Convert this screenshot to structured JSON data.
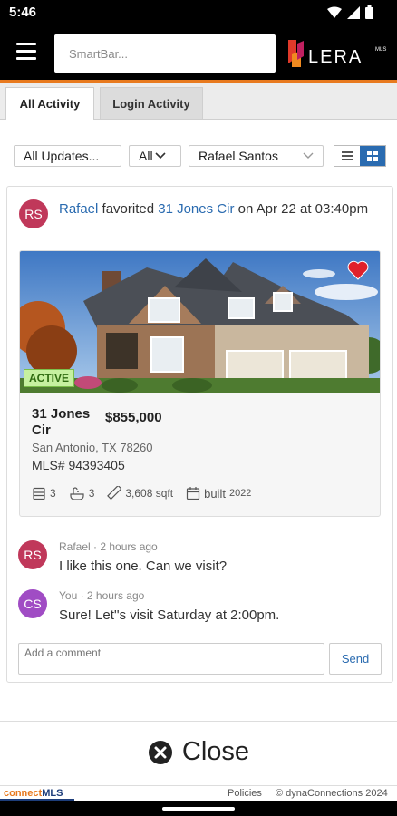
{
  "status_bar": {
    "time": "5:46"
  },
  "app_bar": {
    "search_placeholder": "SmartBar...",
    "logo_text": "LERA",
    "logo_sup": "MLS"
  },
  "tabs": [
    {
      "label": "All Activity"
    },
    {
      "label": "Login Activity"
    }
  ],
  "filters": {
    "updates": "All Updates...",
    "scope": "All",
    "agent": "Rafael Santos"
  },
  "activity": {
    "avatar_initials": "RS",
    "user": "Rafael",
    "verb": " favorited ",
    "listing_link": "31 Jones Cir",
    "date_text": " on Apr 22 at 03:40pm"
  },
  "listing": {
    "status": "ACTIVE",
    "street": "31 Jones Cir",
    "price": "$855,000",
    "city": "San Antonio, TX 78260",
    "mls": "MLS# 94393405",
    "beds": "3",
    "baths": "3",
    "sqft": "3,608 sqft",
    "built_label": "built",
    "built_year": "2022"
  },
  "comments": [
    {
      "initials": "RS",
      "meta": "Rafael · 2 hours ago",
      "text": "I like this one. Can we visit?"
    },
    {
      "initials": "CS",
      "meta": "You · 2 hours ago",
      "text": "Sure! Let''s visit Saturday at 2:00pm."
    }
  ],
  "comment_box": {
    "placeholder": "Add a comment",
    "send_label": "Send"
  },
  "close_bar": {
    "label": "Close"
  },
  "footer": {
    "brand_connect": "connect",
    "brand_mls": "MLS",
    "policies": "Policies",
    "copyright": "© dynaConnections 2024"
  },
  "colors": {
    "accent_orange": "#e87a1f",
    "link_blue": "#2a6bb0",
    "avatar_rs": "#c0385a",
    "avatar_cs": "#a04cc4",
    "active_badge": "#c6f0a0",
    "heart": "#e0202a"
  }
}
